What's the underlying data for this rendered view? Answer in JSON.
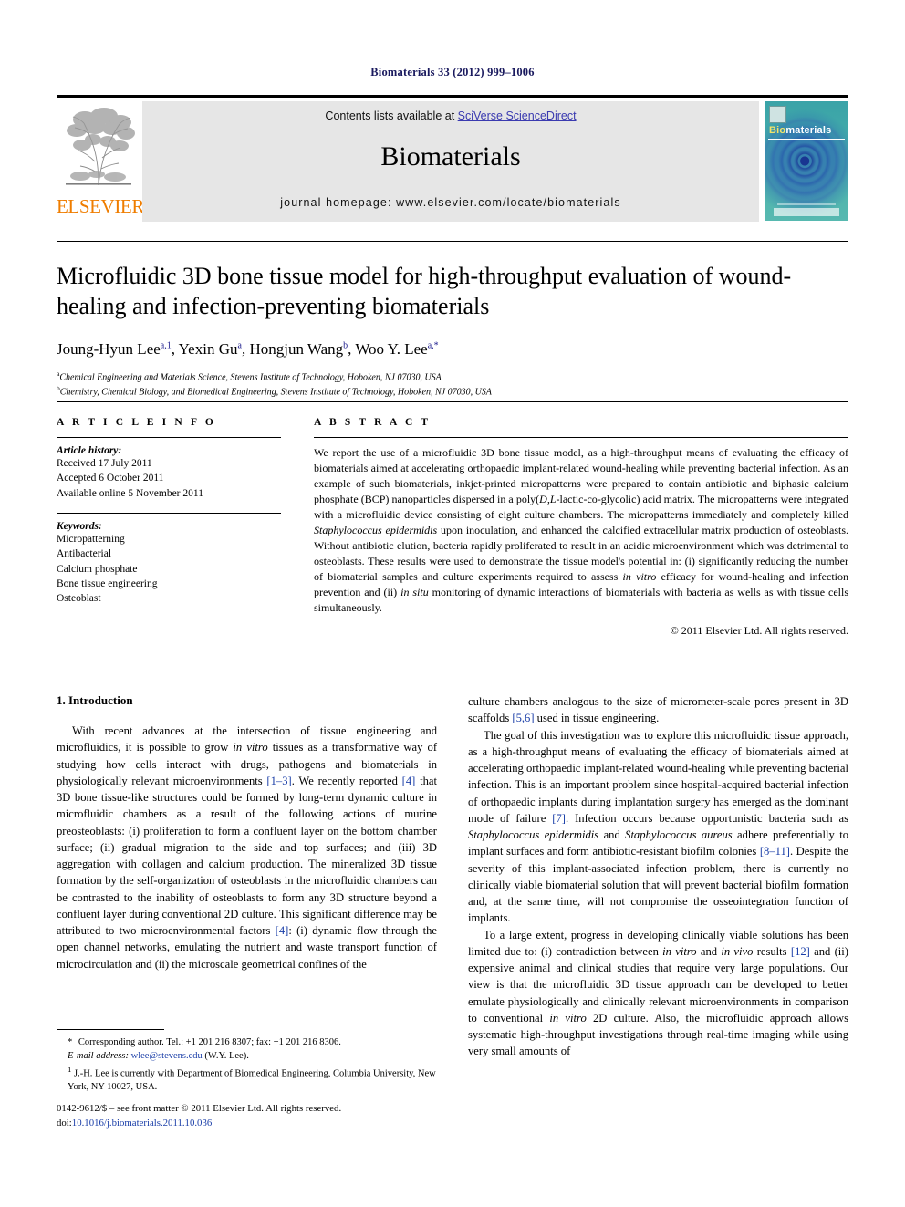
{
  "running_head": "Biomaterials 33 (2012) 999–1006",
  "masthead": {
    "contents_prefix": "Contents lists available at ",
    "sciencedirect": "SciVerse ScienceDirect",
    "journal_name": "Biomaterials",
    "homepage": "journal homepage: www.elsevier.com/locate/biomaterials",
    "publisher_wordmark": "ELSEVIER",
    "cover_title_part1": "Bio",
    "cover_title_part2": "materials",
    "colors": {
      "link_blue": "#3a3ab0",
      "elsevier_orange": "#ef7d00",
      "band_gray": "#e6e6e6",
      "cover_teal": "#49b1ab",
      "cover_blue": "#2a58a8"
    }
  },
  "article": {
    "title": "Microfluidic 3D bone tissue model for high-throughput evaluation of wound-healing and infection-preventing biomaterials",
    "authors": [
      {
        "name": "Joung-Hyun Lee",
        "sup": "a,1"
      },
      {
        "name": "Yexin Gu",
        "sup": "a"
      },
      {
        "name": "Hongjun Wang",
        "sup": "b"
      },
      {
        "name": "Woo Y. Lee",
        "sup": "a,*"
      }
    ],
    "affiliations": [
      {
        "marker": "a",
        "text": "Chemical Engineering and Materials Science, Stevens Institute of Technology, Hoboken, NJ 07030, USA"
      },
      {
        "marker": "b",
        "text": "Chemistry, Chemical Biology, and Biomedical Engineering, Stevens Institute of Technology, Hoboken, NJ 07030, USA"
      }
    ]
  },
  "info": {
    "heading": "A R T I C L E   I N F O",
    "history_label": "Article history:",
    "history": [
      "Received 17 July 2011",
      "Accepted 6 October 2011",
      "Available online 5 November 2011"
    ],
    "keywords_label": "Keywords:",
    "keywords": [
      "Micropatterning",
      "Antibacterial",
      "Calcium phosphate",
      "Bone tissue engineering",
      "Osteoblast"
    ]
  },
  "abstract": {
    "heading": "A B S T R A C T",
    "copyright": "© 2011 Elsevier Ltd. All rights reserved."
  },
  "sections": {
    "introduction_title": "1. Introduction"
  },
  "footnotes": {
    "corresponding_marker": "*",
    "corresponding_text": "Corresponding author. Tel.: +1 201 216 8307; fax: +1 201 216 8306.",
    "email_label": "E-mail address:",
    "email": "wlee@stevens.edu",
    "email_owner": "(W.Y. Lee).",
    "note1_marker": "1",
    "note1_text": "J.-H. Lee is currently with Department of Biomedical Engineering, Columbia University, New York, NY 10027, USA."
  },
  "imprint": {
    "issn_line": "0142-9612/$ – see front matter © 2011 Elsevier Ltd. All rights reserved.",
    "doi_prefix": "doi:",
    "doi": "10.1016/j.biomaterials.2011.10.036"
  }
}
